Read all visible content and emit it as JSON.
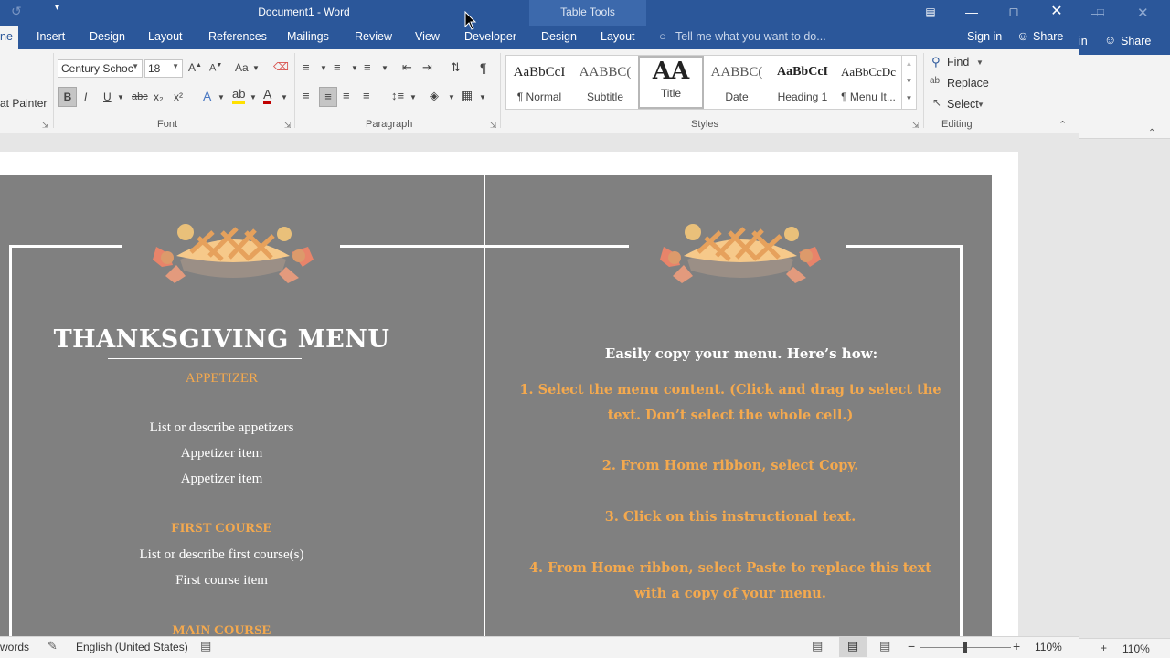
{
  "window": {
    "title": "Document1 - Word",
    "contextual_group": "Table Tools"
  },
  "tabs": [
    {
      "label": "ne",
      "active": true
    },
    {
      "label": "Insert"
    },
    {
      "label": "Design"
    },
    {
      "label": "Layout"
    },
    {
      "label": "References"
    },
    {
      "label": "Mailings"
    },
    {
      "label": "Review"
    },
    {
      "label": "View"
    },
    {
      "label": "Developer"
    },
    {
      "label": "Design"
    },
    {
      "label": "Layout"
    }
  ],
  "tell_me": "Tell me what you want to do...",
  "account": {
    "sign_in": "Sign in",
    "share": "Share"
  },
  "ribbon": {
    "clipboard": {
      "format_painter": "at Painter"
    },
    "font": {
      "name": "Century Schoc",
      "size": "18",
      "group_label": "Font",
      "bold": "B",
      "italic": "I",
      "underline": "U",
      "strike": "abc",
      "sub": "x₂",
      "sup": "x²",
      "change_case": "Aa"
    },
    "paragraph": {
      "group_label": "Paragraph"
    },
    "styles": {
      "group_label": "Styles",
      "items": [
        {
          "preview": "AaBbCcI",
          "label": "¶ Normal"
        },
        {
          "preview": "AABBC(",
          "label": "Subtitle"
        },
        {
          "preview": "AA",
          "label": "Title",
          "selected": true
        },
        {
          "preview": "AABBC(",
          "label": "Date"
        },
        {
          "preview": "AaBbCcI",
          "label": "Heading 1"
        },
        {
          "preview": "AaBbCcDc",
          "label": "¶ Menu It..."
        }
      ]
    },
    "editing": {
      "group_label": "Editing",
      "find": "Find",
      "replace": "Replace",
      "select": "Select"
    }
  },
  "document": {
    "left": {
      "title": "THANKSGIVING MENU",
      "appetizer_heading": "APPETIZER",
      "appetizer_desc": "List or describe appetizers",
      "appetizer_items": [
        "Appetizer item",
        "Appetizer item"
      ],
      "first_course_heading": "FIRST COURSE",
      "first_course_desc": "List or describe first course(s)",
      "first_course_items": [
        "First course item"
      ],
      "main_course_heading": "MAIN COURSE"
    },
    "right": {
      "heading": "Easily copy your menu. Here’s how:",
      "steps": [
        "1. Select the menu content. (Click and drag to select the text. Don’t select the whole cell.)",
        "2. From Home ribbon, select Copy.",
        "3. Click on this instructional text.",
        "4. From Home ribbon, select Paste to replace this text with a copy of your menu."
      ]
    }
  },
  "status": {
    "words": "words",
    "language": "English (United States)",
    "zoom": "110%"
  },
  "background_window": {
    "tab_partial": "in",
    "share": "Share",
    "zoom": "110%"
  },
  "colors": {
    "word_blue": "#2b579a",
    "cell_gray": "#808080",
    "accent_orange": "#f4a94e"
  }
}
